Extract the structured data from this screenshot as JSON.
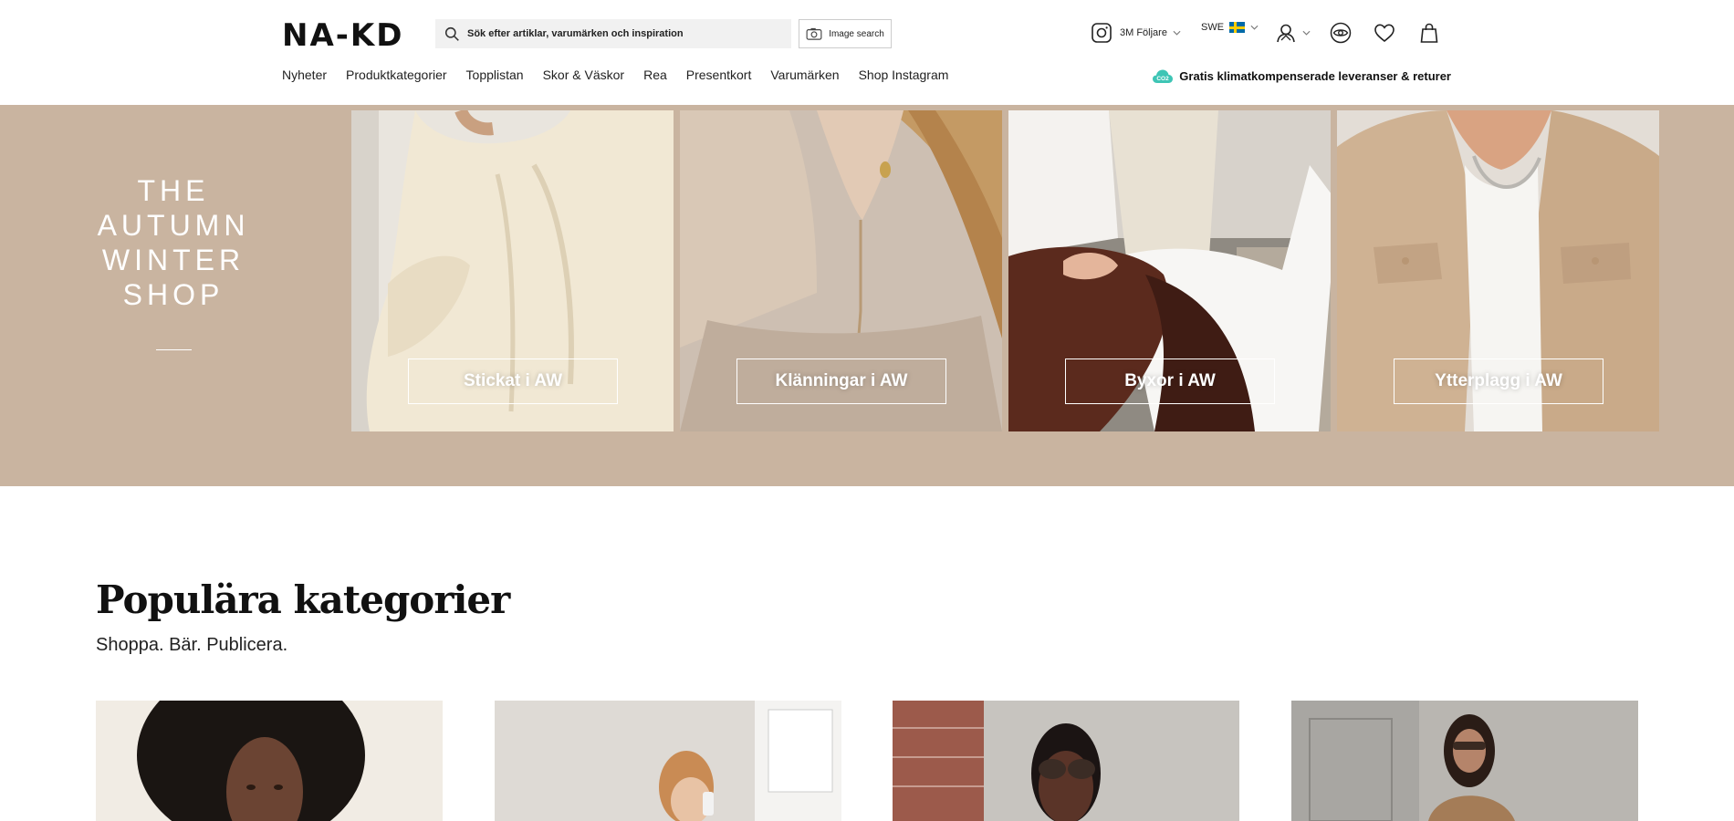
{
  "header": {
    "logo_text": "NA-KD",
    "search_placeholder": "Sök efter artiklar, varumärken och inspiration",
    "image_search_label": "Image search",
    "instagram_followers": "3M Följare",
    "language": "SWE",
    "icons": [
      "instagram-icon",
      "flag-sweden-icon",
      "account-icon",
      "recently-viewed-eye-icon",
      "heart-icon",
      "shopping-bag-icon"
    ]
  },
  "nav": {
    "items": [
      "Nyheter",
      "Produktkategorier",
      "Topplistan",
      "Skor & Väskor",
      "Rea",
      "Presentkort",
      "Varumärken",
      "Shop Instagram"
    ]
  },
  "promo": {
    "badge": "CO2",
    "text": "Gratis klimatkompenserade leveranser & returer",
    "color": "#3ec5b5"
  },
  "hero": {
    "title_lines": [
      "THE",
      "AUTUMN",
      "WINTER",
      "SHOP"
    ],
    "background": "#c9b4a0",
    "tiles": [
      {
        "label": "Stickat i AW"
      },
      {
        "label": "Klänningar i AW"
      },
      {
        "label": "Byxor i AW"
      },
      {
        "label": "Ytterplagg i AW"
      }
    ]
  },
  "popular": {
    "title": "Populära kategorier",
    "subtitle": "Shoppa. Bär. Publicera."
  }
}
